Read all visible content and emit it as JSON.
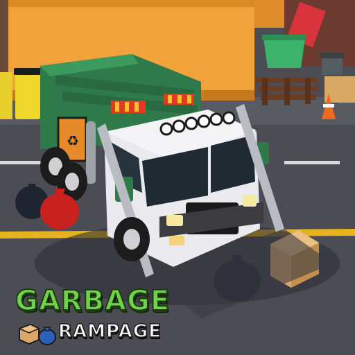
{
  "game": {
    "title_line1": "GARBAGE",
    "title_line2": "RAMPAGE"
  },
  "scene": {
    "vehicle": "garbage-truck",
    "colors": {
      "truck_body_green": "#2f7a4a",
      "truck_cab_white": "#e9e9ee",
      "container_orange": "#f2a23a",
      "road": "#4a4a52",
      "road_line_yellow": "#e6b21e",
      "title_green": "#6fd44a"
    },
    "icons": [
      "cardboard-box-icon",
      "garbage-bag-icon"
    ]
  }
}
